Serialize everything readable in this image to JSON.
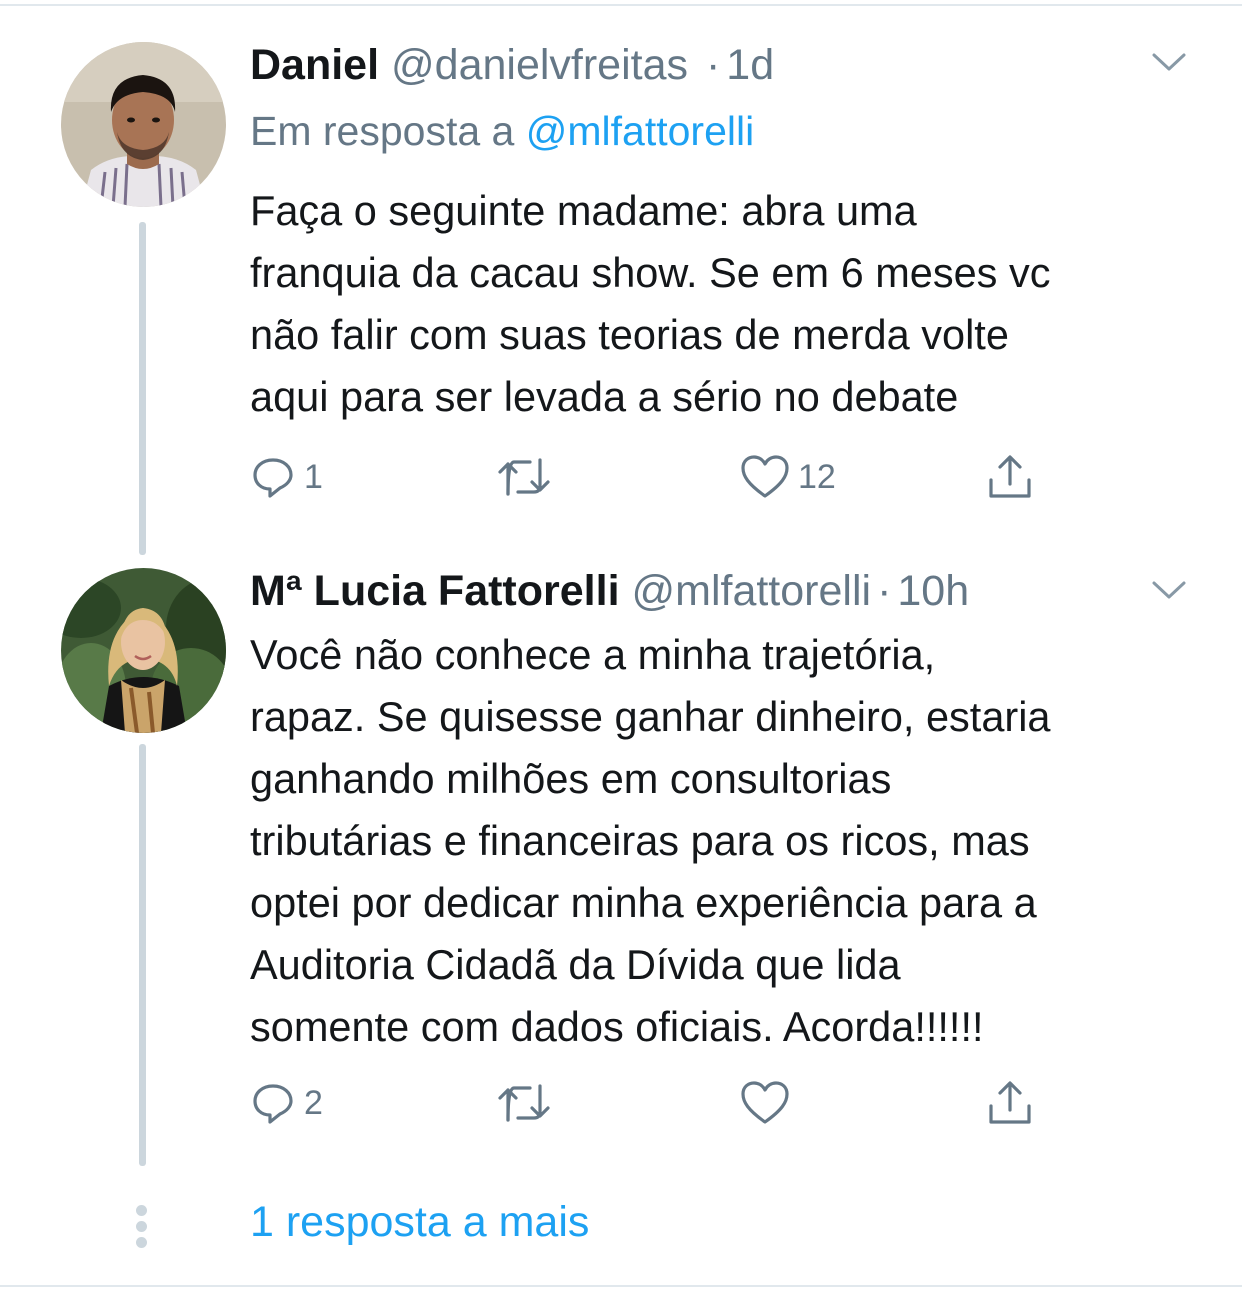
{
  "tweets": [
    {
      "name": "Daniel",
      "handle": "@danielvfreitas",
      "separator": "·",
      "time": "1d",
      "reply_prefix": "Em resposta a",
      "reply_handle": "@mlfattorelli",
      "text_lines": [
        "Faça o seguinte madame: abra uma",
        "franquia da cacau show. Se em 6 meses vc",
        "não falir com suas teorias de merda volte",
        "aqui para ser levada a sério no debate"
      ],
      "replies": "1",
      "retweets": "",
      "likes": "12",
      "icons": [
        "reply-icon",
        "retweet-icon",
        "like-icon",
        "share-icon",
        "chevron-down-icon"
      ]
    },
    {
      "name": "Mª Lucia Fattorelli",
      "handle": "@mlfattorelli",
      "separator": "·",
      "time": "10h",
      "text_lines": [
        "Você não conhece a minha trajetória,",
        "rapaz. Se quisesse ganhar dinheiro, estaria",
        "ganhando milhões em consultorias",
        "tributárias e financeiras para os ricos, mas",
        "optei por dedicar minha experiência para a",
        "Auditoria Cidadã da Dívida que lida",
        "somente com dados oficiais. Acorda!!!!!!"
      ],
      "replies": "2",
      "retweets": "",
      "likes": "",
      "icons": [
        "reply-icon",
        "retweet-icon",
        "like-icon",
        "share-icon",
        "chevron-down-icon"
      ]
    }
  ],
  "more_replies_label": "1 resposta a mais",
  "colors": {
    "text": "#14171a",
    "muted": "#657786",
    "link": "#1da1f2",
    "line": "#ccd6dd"
  }
}
